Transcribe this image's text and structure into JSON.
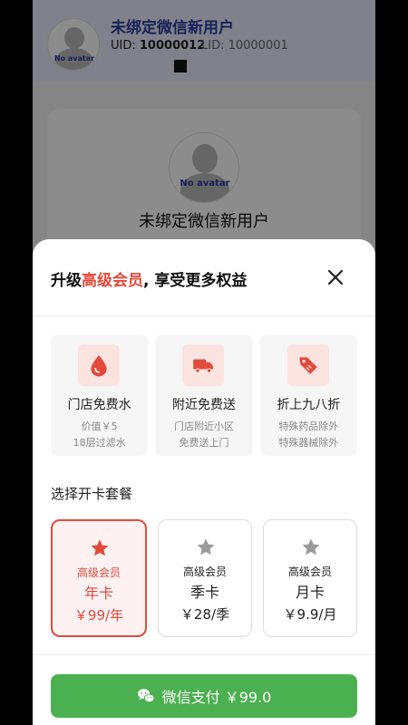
{
  "background": {
    "user_name": "未绑定微信新用户",
    "uid_label": "UID:",
    "uid_value": "10000012",
    "lid_text": "LID: 10000001",
    "avatar_text": "No avatar",
    "card_user_name": "未绑定微信新用户"
  },
  "sheet": {
    "title_prefix": "升级",
    "title_highlight": "高级会员",
    "title_suffix": ", 享受更多权益",
    "benefits": [
      {
        "icon": "water-drop-icon",
        "title": "门店免费水",
        "line1": "价值￥5",
        "line2": "18层过滤水"
      },
      {
        "icon": "delivery-truck-icon",
        "title": "附近免费送",
        "line1": "门店附近小区",
        "line2": "免费送上门"
      },
      {
        "icon": "discount-tag-icon",
        "title": "折上九八折",
        "line1": "特殊药品除外",
        "line2": "特殊器械除外"
      }
    ],
    "plan_section_label": "选择开卡套餐",
    "plans": [
      {
        "level": "高级会员",
        "name": "年卡",
        "price": "￥99/年",
        "selected": true
      },
      {
        "level": "高级会员",
        "name": "季卡",
        "price": "￥28/季",
        "selected": false
      },
      {
        "level": "高级会员",
        "name": "月卡",
        "price": "￥9.9/月",
        "selected": false
      }
    ],
    "pay_button_label": "微信支付 ￥99.0"
  },
  "colors": {
    "accent": "#e24a3b",
    "pay_green": "#4bb04f",
    "icon_bg": "#fbe3e0",
    "star_gray": "#9a9a9a"
  }
}
